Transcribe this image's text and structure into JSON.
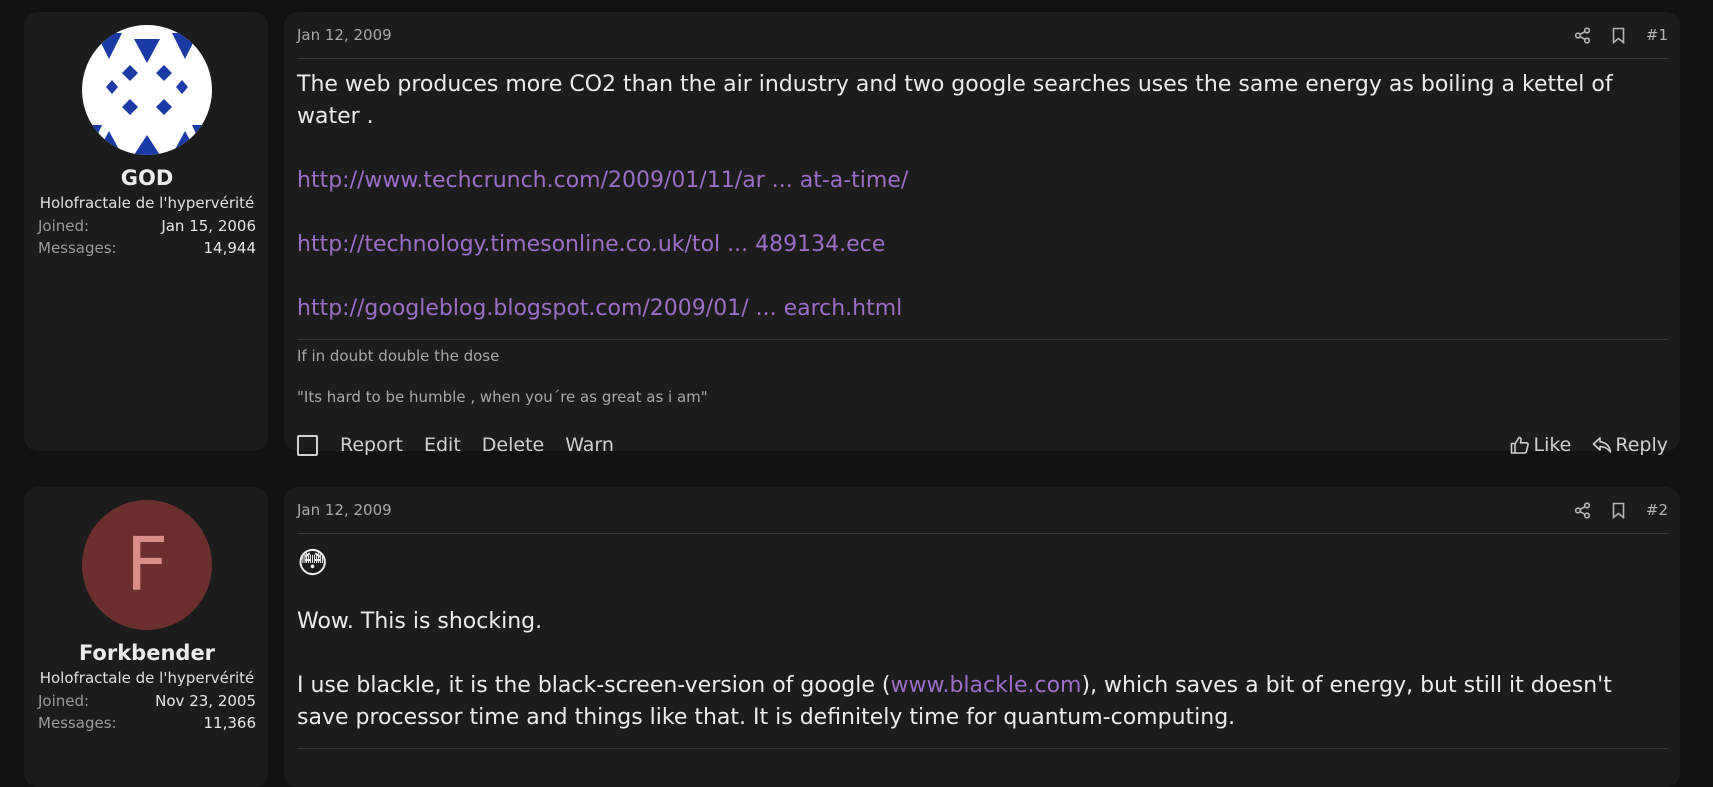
{
  "posts": [
    {
      "user": {
        "name": "GOD",
        "title": "Holofractale de l'hypervérité",
        "joined_label": "Joined:",
        "joined": "Jan 15, 2006",
        "messages_label": "Messages:",
        "messages": "14,944",
        "avatar_icon": "triangle-pattern-avatar"
      },
      "date": "Jan 12, 2009",
      "number": "#1",
      "body": {
        "text": "The web produces more CO2 than the air industry and two google searches uses the same energy as boiling a kettel of water .",
        "links": [
          "http://www.techcrunch.com/2009/01/11/ar ... at-a-time/",
          "http://technology.timesonline.co.uk/tol ... 489134.ece",
          "http://googleblog.blogspot.com/2009/01/ ... earch.html"
        ]
      },
      "signature": [
        "If in doubt double the dose",
        "\"Its hard to be humble , when you´re as great as i am\""
      ],
      "actions": {
        "report": "Report",
        "edit": "Edit",
        "delete": "Delete",
        "warn": "Warn",
        "like": "Like",
        "reply": "Reply"
      }
    },
    {
      "user": {
        "name": "Forkbender",
        "title": "Holofractale de l'hypervérité",
        "joined_label": "Joined:",
        "joined": "Nov 23, 2005",
        "messages_label": "Messages:",
        "messages": "11,366",
        "avatar_letter": "F"
      },
      "date": "Jan 12, 2009",
      "number": "#2",
      "body": {
        "emoji": "😳",
        "line1": "Wow. This is shocking.",
        "line2_before": "I use blackle, it is the black-screen-version of google (",
        "line2_link": "www.blackle.com",
        "line2_after": "), which saves a bit of energy, but still it doesn't save processor time and things like that. It is definitely time for quantum-computing."
      }
    }
  ],
  "colors": {
    "background": "#121212",
    "panel": "#1c1c1c",
    "link": "#9b6ec7",
    "avatar_f": "#6b2f2d"
  }
}
